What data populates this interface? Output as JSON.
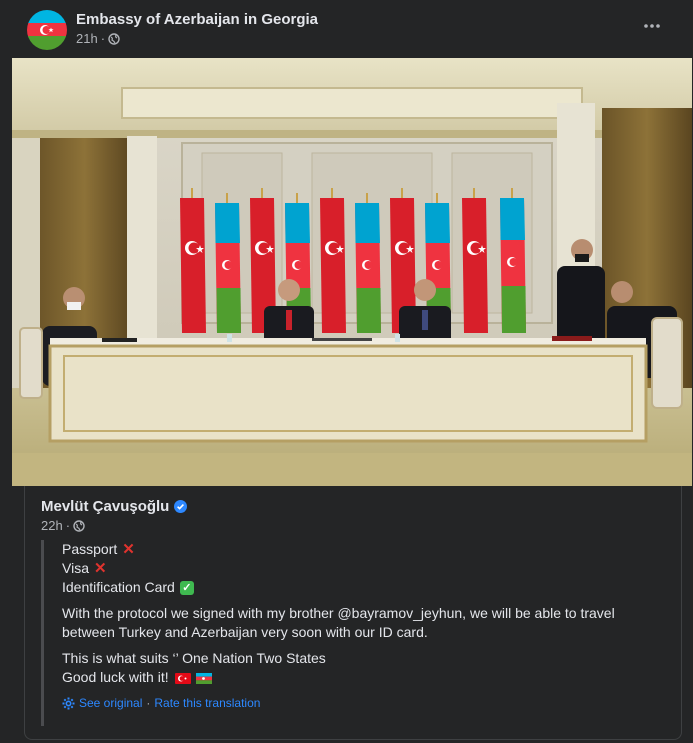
{
  "page": {
    "name": "Embassy of Azerbaijan in Georgia",
    "time": "21h",
    "audience_icon": "globe-icon",
    "more_icon": "more-options-icon"
  },
  "photo": {
    "subject": "Two leaders seated at a signing table in front of Turkish and Azerbaijani flags"
  },
  "shared_post": {
    "author": "Mevlüt Çavuşoğlu",
    "verified_icon": "verified-badge-icon",
    "time": "22h",
    "audience_icon": "globe-icon",
    "lines": [
      {
        "text": "Passport",
        "mark": "x"
      },
      {
        "text": "Visa",
        "mark": "x"
      },
      {
        "text": "Identification Card",
        "mark": "check"
      }
    ],
    "paragraph1": "With the protocol we signed with my brother @bayramov_jeyhun, we will be able to travel between Turkey and Azerbaijan very soon with our ID card.",
    "paragraph2_line1": "This is what suits ‘’ One Nation Two States",
    "paragraph2_line2": "Good luck with it!",
    "see_original": "See original",
    "separator": "·",
    "rate_translation": "Rate this translation"
  },
  "colors": {
    "background": "#242526",
    "text": "#e4e6eb",
    "secondary_text": "#b0b3b8",
    "link": "#2d88ff",
    "turkey_red": "#e30a17",
    "azerbaijan_blue": "#00b5e2",
    "azerbaijan_red": "#ef3340",
    "azerbaijan_green": "#509e2f"
  }
}
